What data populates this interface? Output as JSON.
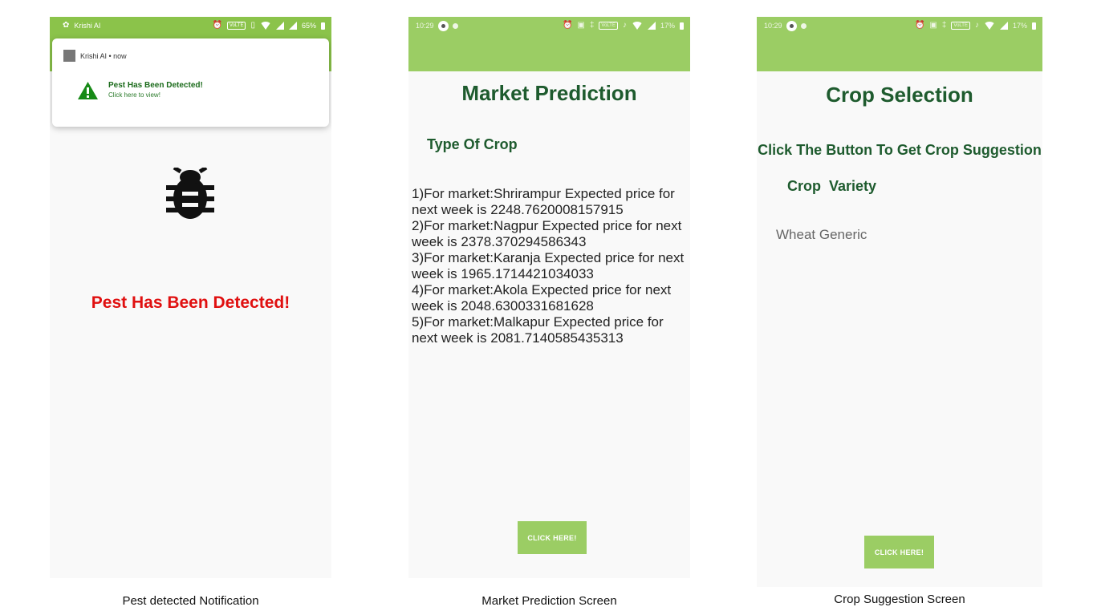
{
  "screens": {
    "pest": {
      "status_app": "Krishi AI",
      "status_battery": "65%",
      "status_volte": "VoLTE",
      "notification": {
        "app": "Krishi AI",
        "time": "now",
        "title": "Pest Has Been Detected!",
        "subtitle": "Click here to view!"
      },
      "icon": "bug-icon",
      "message": "Pest Has Been Detected!",
      "caption": "Pest detected Notification"
    },
    "market": {
      "status_time": "10:29",
      "status_battery": "17%",
      "status_volte": "VoLTE",
      "title": "Market Prediction",
      "crop_label": "Type Of Crop",
      "predictions": [
        "1)For market:Shrirampur Expected price for next week is 2248.7620008157915",
        "2)For market:Nagpur Expected price for next week is 2378.370294586343",
        "3)For market:Karanja Expected price for next week is 1965.1714421034033",
        "4)For market:Akola Expected price for next week is 2048.6300331681628",
        "5)For market:Malkapur Expected price for next week is 2081.7140585435313"
      ],
      "button": "CLICK HERE!",
      "caption": "Market Prediction Screen"
    },
    "crop": {
      "status_time": "10:29",
      "status_battery": "17%",
      "status_volte": "VoLTE",
      "title": "Crop Selection",
      "instruction": "Click The Button To Get Crop Suggestion",
      "col_crop": "Crop",
      "col_variety": "Variety",
      "result": "Wheat Generic",
      "button": "CLICK HERE!",
      "caption": "Crop Suggestion Screen"
    }
  },
  "colors": {
    "green_bar": "#9bcd64",
    "dark_green_text": "#1e5b2e",
    "alert_red": "#e01010"
  }
}
